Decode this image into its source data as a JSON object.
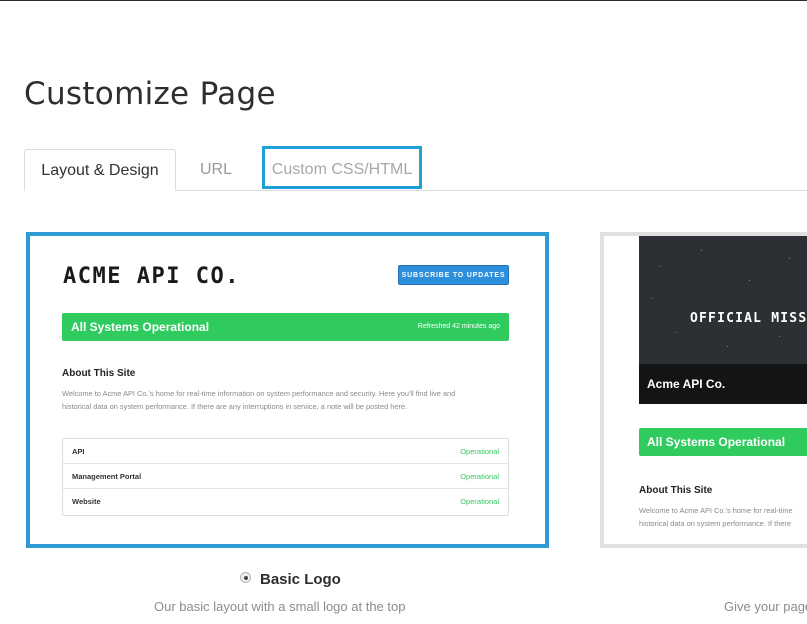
{
  "page": {
    "title": "Customize Page"
  },
  "tabs": [
    {
      "label": "Layout & Design",
      "active": true
    },
    {
      "label": "URL",
      "active": false
    },
    {
      "label": "Custom CSS/HTML",
      "active": false,
      "highlighted": true
    }
  ],
  "colors": {
    "accent_blue": "#2f9bd6",
    "status_green": "#2fcb5f",
    "subscribe_blue": "#2c8fdc",
    "highlight_box": "#1f9fd7"
  },
  "templates": [
    {
      "selected": true,
      "preview": {
        "logo_text": "ACME API CO.",
        "subscribe_label": "SUBSCRIBE TO UPDATES",
        "status_text": "All Systems Operational",
        "refreshed_text": "Refreshed 42 minutes ago",
        "about_title": "About This Site",
        "about_line1": "Welcome to Acme API Co.'s home for real-time information on system performance and security. Here you'll find live and",
        "about_line2": "historical data on system performance. If there are any interruptions in service, a note will be posted here.",
        "components": [
          {
            "name": "API",
            "status": "Operational"
          },
          {
            "name": "Management Portal",
            "status": "Operational"
          },
          {
            "name": "Website",
            "status": "Operational"
          }
        ]
      },
      "label": "Basic Logo",
      "description": "Our basic layout with a small logo at the top"
    },
    {
      "selected": false,
      "preview": {
        "hero_title": "OFFICIAL MISSION",
        "company_name": "Acme API Co.",
        "status_text": "All Systems Operational",
        "about_title": "About This Site",
        "about_line1": "Welcome to Acme API Co.'s home for real-time",
        "about_line2": "historical data on system performance. If there"
      },
      "description": "Give your page"
    }
  ]
}
